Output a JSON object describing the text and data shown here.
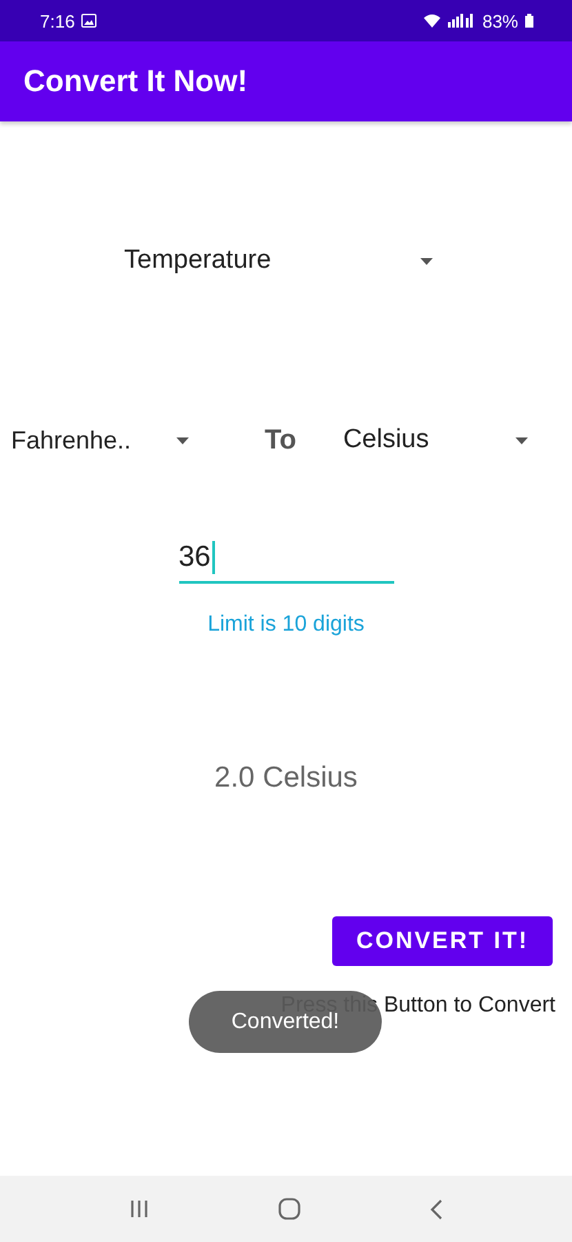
{
  "status_bar": {
    "time": "7:16",
    "battery": "83%"
  },
  "app_bar": {
    "title": "Convert It Now!"
  },
  "category_spinner": {
    "value": "Temperature"
  },
  "from_spinner": {
    "value": "Fahrenhe.."
  },
  "to_label": "To",
  "to_spinner": {
    "value": "Celsius"
  },
  "input": {
    "value": "36",
    "focused": true
  },
  "helper_text": "Limit is 10 digits",
  "result": "2.0 Celsius",
  "convert_button": "CONVERT IT!",
  "button_hint": "Press this Button to Convert",
  "toast": "Converted!"
}
